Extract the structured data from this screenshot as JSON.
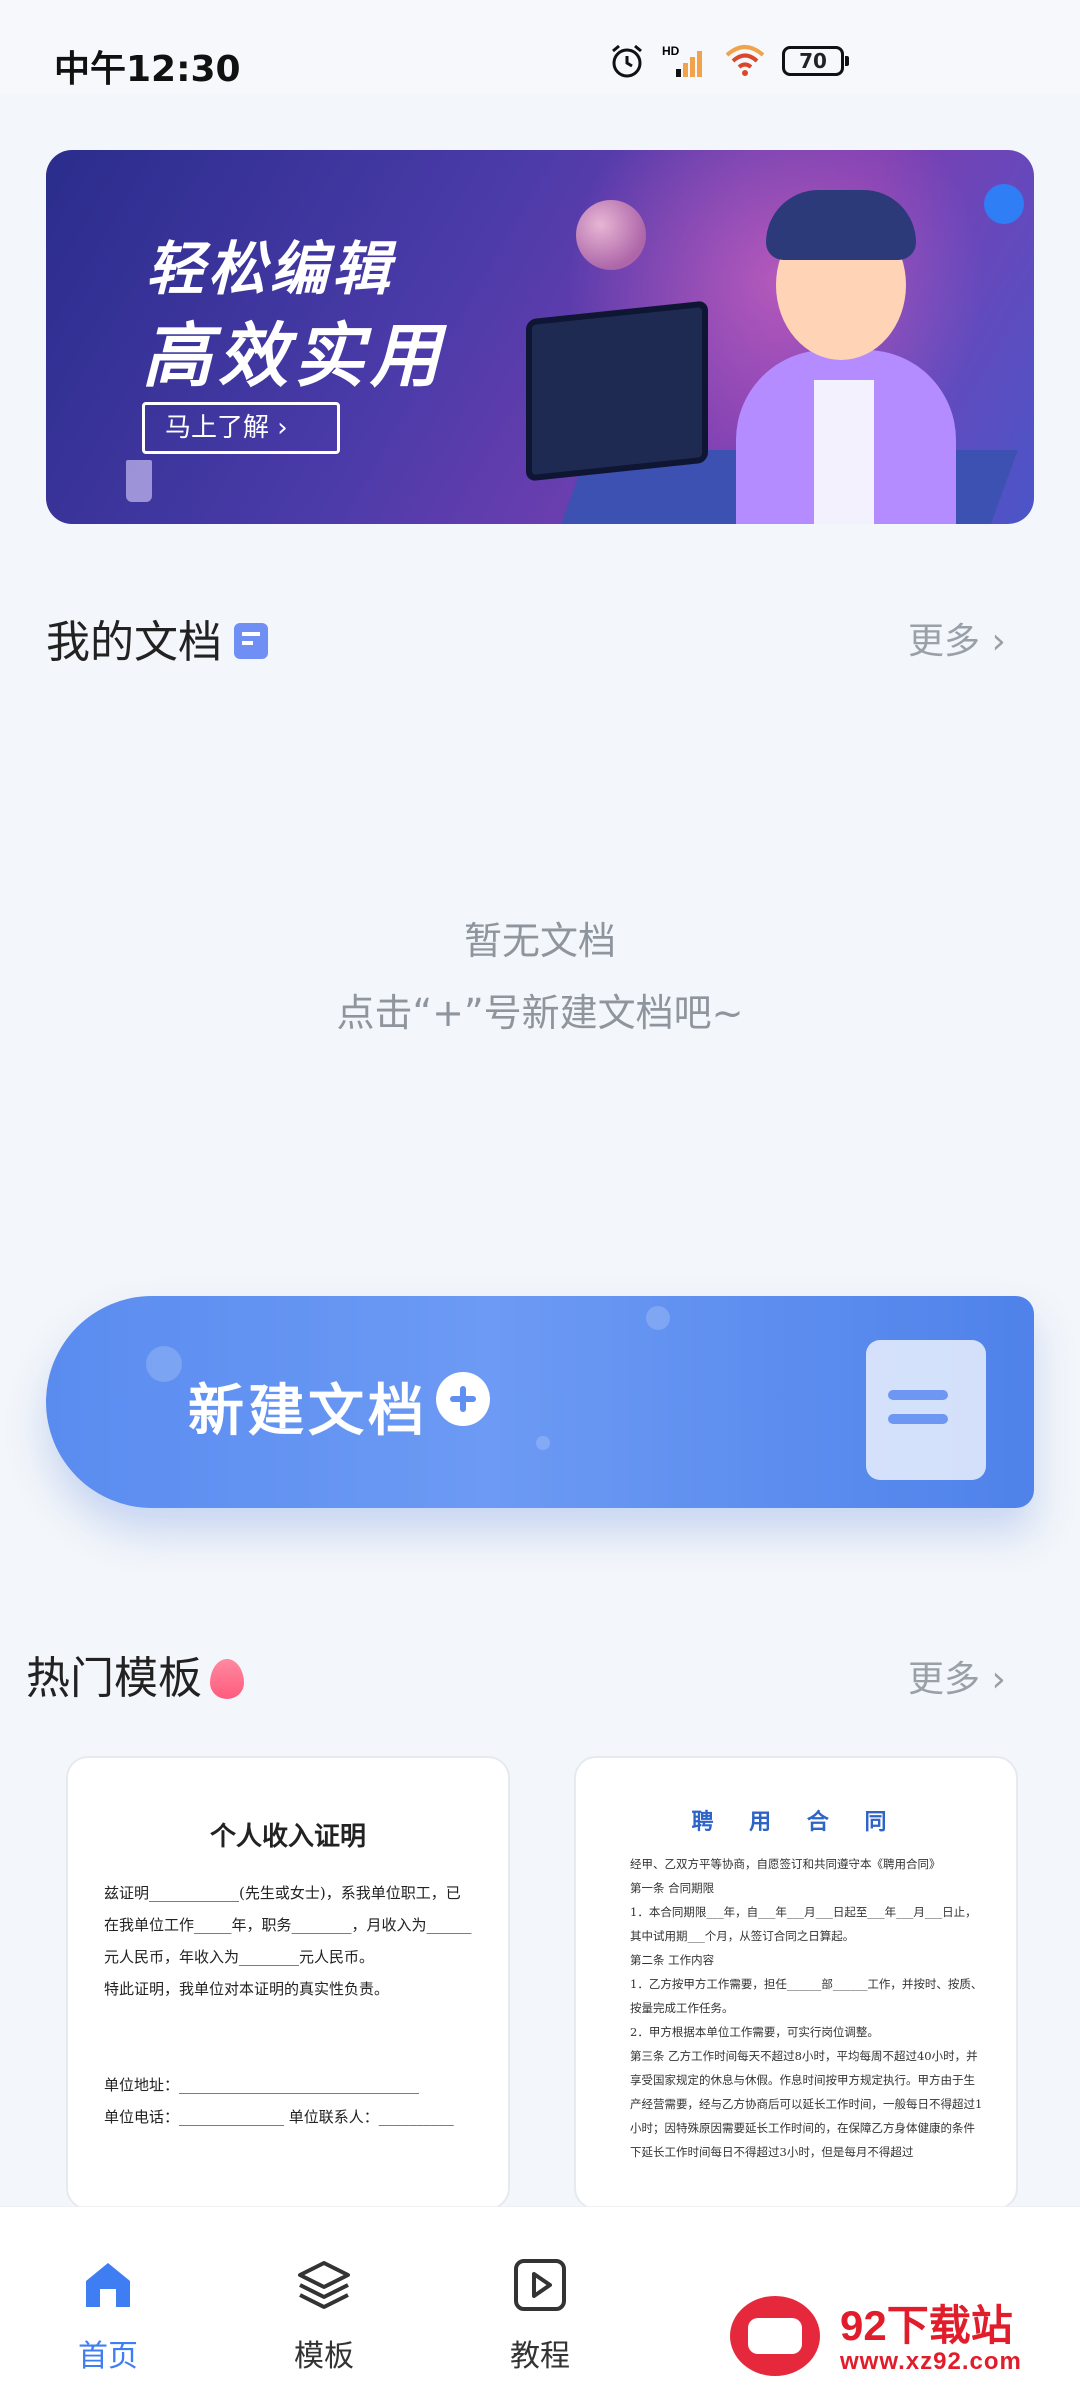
{
  "status_bar": {
    "time": "中午12:30",
    "battery": "70"
  },
  "banner": {
    "line1": "轻松编辑",
    "line2": "高效实用",
    "button": "马上了解 ›"
  },
  "my_docs": {
    "title": "我的文档",
    "more": "更多 ›",
    "empty_line1": "暂无文档",
    "empty_line2": "点击“+”号新建文档吧~"
  },
  "new_doc": {
    "label": "新建文档"
  },
  "hot_templates": {
    "title": "热门模板",
    "more": "更多 ›",
    "cards": [
      {
        "title": "个人收入证明",
        "body": "兹证明____________(先生或女士)，系我单位职工，已在我单位工作_____年，职务________，月收入为______元人民币，年收入为________元人民币。\n特此证明，我单位对本证明的真实性负责。\n\n\n单位地址：________________________________\n单位电话：______________ 单位联系人：__________"
      },
      {
        "title": "聘 用 合 同",
        "body": "经甲、乙双方平等协商，自愿签订和共同遵守本《聘用合同》\n第一条 合同期限\n1．本合同期限___年，自___年___月___日起至___年___月___日止，其中试用期___个月，从签订合同之日算起。\n第二条 工作内容\n1．乙方按甲方工作需要，担任______部______工作，并按时、按质、按量完成工作任务。\n2．甲方根据本单位工作需要，可实行岗位调整。\n第三条 乙方工作时间每天不超过8小时，平均每周不超过40小时，并享受国家规定的休息与休假。作息时间按甲方规定执行。甲方由于生产经营需要，经与乙方协商后可以延长工作时间，一般每日不得超过1小时；因特殊原因需要延长工作时间的，在保障乙方身体健康的条件下延长工作时间每日不得超过3小时，但是每月不得超过"
      }
    ]
  },
  "bottom_nav": {
    "items": [
      {
        "label": "首页"
      },
      {
        "label": "模板"
      },
      {
        "label": "教程"
      }
    ]
  },
  "watermark": {
    "title": "92下载站",
    "url": "www.xz92.com"
  },
  "colors": {
    "accent": "#3f7df2",
    "newdoc_gradient": "#5a8cf0",
    "watermark": "#e11d2b"
  }
}
